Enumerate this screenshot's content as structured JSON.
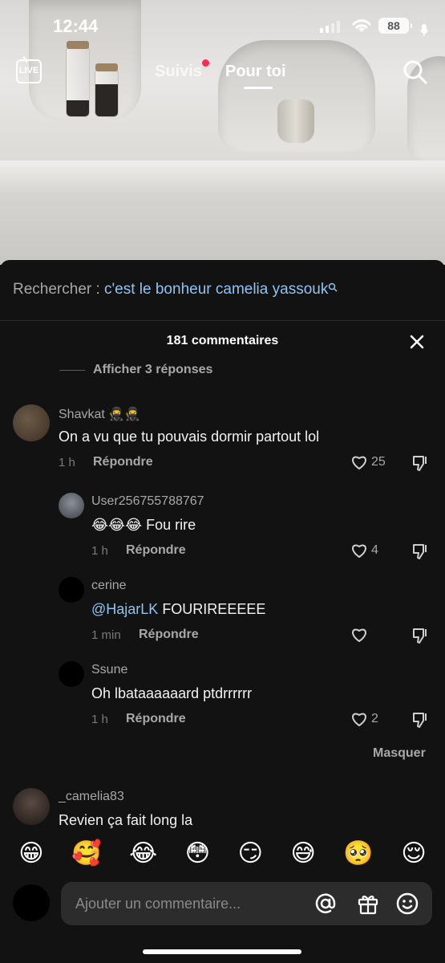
{
  "status_bar": {
    "time": "12:44",
    "battery": "88"
  },
  "nav": {
    "live_label": "LIVE",
    "following": "Suivis",
    "for_you": "Pour toi"
  },
  "related_search": {
    "prefix": "Rechercher : ",
    "query": "c'est le bonheur camelia yassouk"
  },
  "comments": {
    "count_label": "181 commentaires",
    "show_replies": "Afficher 3 réponses",
    "hide_label": "Masquer",
    "items": [
      {
        "username": "Shavkat 🥷🥷",
        "text": "On a vu que tu pouvais dormir partout lol",
        "time": "1 h",
        "reply": "Répondre",
        "likes": "25"
      },
      {
        "username": "User256755788767",
        "text": "😂😂😂 Fou rire",
        "time": "1 h",
        "reply": "Répondre",
        "likes": "4"
      },
      {
        "username": "cerine",
        "mention": "@HajarLK",
        "text": " FOURIREEEEE",
        "time": "1 min",
        "reply": "Répondre",
        "likes": ""
      },
      {
        "username": "Ssune",
        "text": "Oh lbataaaaaard ptdrrrrrr",
        "time": "1 h",
        "reply": "Répondre",
        "likes": "2"
      },
      {
        "username": "_camelia83",
        "text": "Revien ça fait long la"
      }
    ]
  },
  "emoji_bar": [
    "😁",
    "🥰",
    "😂",
    "😳",
    "😏",
    "😅",
    "🥺",
    "😌"
  ],
  "composer": {
    "placeholder": "Ajouter un commentaire..."
  },
  "colors": {
    "accent_red": "#fe2c55",
    "mention_blue": "#8fc4f2",
    "sheet_bg": "#121212"
  }
}
